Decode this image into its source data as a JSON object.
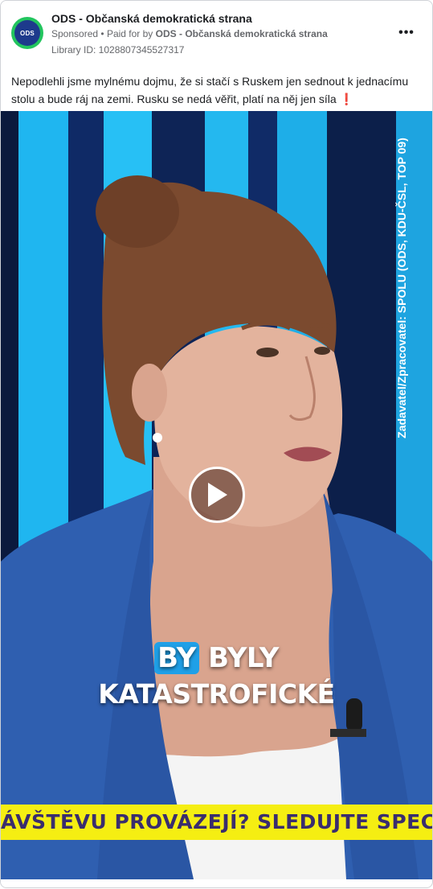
{
  "ad": {
    "page_name": "ODS - Občanská demokratická strana",
    "avatar_text": "ODS",
    "sponsored_label": "Sponsored",
    "separator": "•",
    "paid_for_prefix": "Paid for by",
    "paid_for_by": "ODS - Občanská demokratická strana",
    "library_id": "Library ID: 1028807345527317",
    "more_label": "•••",
    "body_text": "Nepodlehli jsme mylnému dojmu, že si stačí s Ruskem jen sednout k jednacímu stolu a bude ráj na zemi. Rusku se nedá věřit, platí na něj jen síla",
    "body_emoji": "❗"
  },
  "video": {
    "side_credit": "Zadavatel/Zpracovatel: SPOLU (ODS, KDU-ČSL, TOP 09)",
    "caption_highlight": "BY",
    "caption_line1_rest": " BYLY",
    "caption_line2": "KATASTROFICKÉ",
    "ticker_text": "ÁVŠTĚVU PROVÁZEJÍ? SLEDUJTE SPECIÁL",
    "colors": {
      "stripe_blue": "#1fb6f0",
      "ticker_yellow": "#f5ee12",
      "jacket_blue": "#2f5fb0",
      "avatar_green": "#22c55e"
    }
  }
}
